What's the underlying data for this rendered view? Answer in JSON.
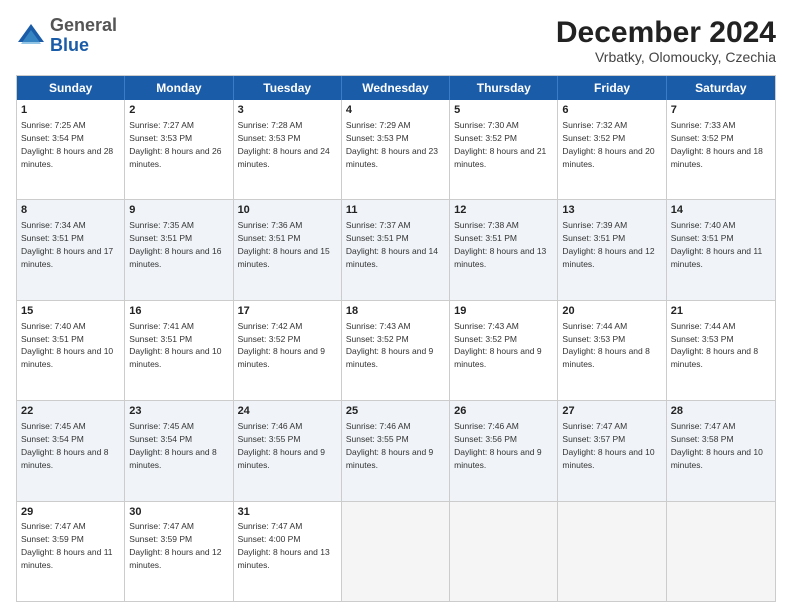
{
  "header": {
    "logo_line1": "General",
    "logo_line2": "Blue",
    "month": "December 2024",
    "location": "Vrbatky, Olomoucky, Czechia"
  },
  "days_of_week": [
    "Sunday",
    "Monday",
    "Tuesday",
    "Wednesday",
    "Thursday",
    "Friday",
    "Saturday"
  ],
  "weeks": [
    [
      {
        "day": "1",
        "sunrise": "7:25 AM",
        "sunset": "3:54 PM",
        "daylight": "8 hours and 28 minutes."
      },
      {
        "day": "2",
        "sunrise": "7:27 AM",
        "sunset": "3:53 PM",
        "daylight": "8 hours and 26 minutes."
      },
      {
        "day": "3",
        "sunrise": "7:28 AM",
        "sunset": "3:53 PM",
        "daylight": "8 hours and 24 minutes."
      },
      {
        "day": "4",
        "sunrise": "7:29 AM",
        "sunset": "3:53 PM",
        "daylight": "8 hours and 23 minutes."
      },
      {
        "day": "5",
        "sunrise": "7:30 AM",
        "sunset": "3:52 PM",
        "daylight": "8 hours and 21 minutes."
      },
      {
        "day": "6",
        "sunrise": "7:32 AM",
        "sunset": "3:52 PM",
        "daylight": "8 hours and 20 minutes."
      },
      {
        "day": "7",
        "sunrise": "7:33 AM",
        "sunset": "3:52 PM",
        "daylight": "8 hours and 18 minutes."
      }
    ],
    [
      {
        "day": "8",
        "sunrise": "7:34 AM",
        "sunset": "3:51 PM",
        "daylight": "8 hours and 17 minutes."
      },
      {
        "day": "9",
        "sunrise": "7:35 AM",
        "sunset": "3:51 PM",
        "daylight": "8 hours and 16 minutes."
      },
      {
        "day": "10",
        "sunrise": "7:36 AM",
        "sunset": "3:51 PM",
        "daylight": "8 hours and 15 minutes."
      },
      {
        "day": "11",
        "sunrise": "7:37 AM",
        "sunset": "3:51 PM",
        "daylight": "8 hours and 14 minutes."
      },
      {
        "day": "12",
        "sunrise": "7:38 AM",
        "sunset": "3:51 PM",
        "daylight": "8 hours and 13 minutes."
      },
      {
        "day": "13",
        "sunrise": "7:39 AM",
        "sunset": "3:51 PM",
        "daylight": "8 hours and 12 minutes."
      },
      {
        "day": "14",
        "sunrise": "7:40 AM",
        "sunset": "3:51 PM",
        "daylight": "8 hours and 11 minutes."
      }
    ],
    [
      {
        "day": "15",
        "sunrise": "7:40 AM",
        "sunset": "3:51 PM",
        "daylight": "8 hours and 10 minutes."
      },
      {
        "day": "16",
        "sunrise": "7:41 AM",
        "sunset": "3:51 PM",
        "daylight": "8 hours and 10 minutes."
      },
      {
        "day": "17",
        "sunrise": "7:42 AM",
        "sunset": "3:52 PM",
        "daylight": "8 hours and 9 minutes."
      },
      {
        "day": "18",
        "sunrise": "7:43 AM",
        "sunset": "3:52 PM",
        "daylight": "8 hours and 9 minutes."
      },
      {
        "day": "19",
        "sunrise": "7:43 AM",
        "sunset": "3:52 PM",
        "daylight": "8 hours and 9 minutes."
      },
      {
        "day": "20",
        "sunrise": "7:44 AM",
        "sunset": "3:53 PM",
        "daylight": "8 hours and 8 minutes."
      },
      {
        "day": "21",
        "sunrise": "7:44 AM",
        "sunset": "3:53 PM",
        "daylight": "8 hours and 8 minutes."
      }
    ],
    [
      {
        "day": "22",
        "sunrise": "7:45 AM",
        "sunset": "3:54 PM",
        "daylight": "8 hours and 8 minutes."
      },
      {
        "day": "23",
        "sunrise": "7:45 AM",
        "sunset": "3:54 PM",
        "daylight": "8 hours and 8 minutes."
      },
      {
        "day": "24",
        "sunrise": "7:46 AM",
        "sunset": "3:55 PM",
        "daylight": "8 hours and 9 minutes."
      },
      {
        "day": "25",
        "sunrise": "7:46 AM",
        "sunset": "3:55 PM",
        "daylight": "8 hours and 9 minutes."
      },
      {
        "day": "26",
        "sunrise": "7:46 AM",
        "sunset": "3:56 PM",
        "daylight": "8 hours and 9 minutes."
      },
      {
        "day": "27",
        "sunrise": "7:47 AM",
        "sunset": "3:57 PM",
        "daylight": "8 hours and 10 minutes."
      },
      {
        "day": "28",
        "sunrise": "7:47 AM",
        "sunset": "3:58 PM",
        "daylight": "8 hours and 10 minutes."
      }
    ],
    [
      {
        "day": "29",
        "sunrise": "7:47 AM",
        "sunset": "3:59 PM",
        "daylight": "8 hours and 11 minutes."
      },
      {
        "day": "30",
        "sunrise": "7:47 AM",
        "sunset": "3:59 PM",
        "daylight": "8 hours and 12 minutes."
      },
      {
        "day": "31",
        "sunrise": "7:47 AM",
        "sunset": "4:00 PM",
        "daylight": "8 hours and 13 minutes."
      },
      null,
      null,
      null,
      null
    ]
  ]
}
